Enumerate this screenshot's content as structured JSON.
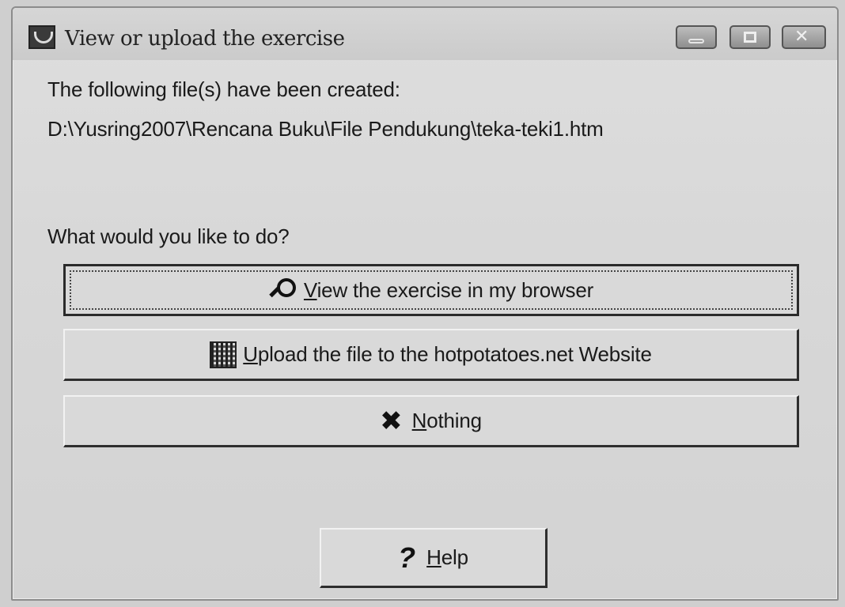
{
  "window": {
    "title": "View or upload the exercise",
    "controls": {
      "minimize": "minimize",
      "maximize": "maximize",
      "close": "close"
    }
  },
  "message": {
    "created_line": "The following file(s) have been created:",
    "file_path": "D:\\Yusring2007\\Rencana Buku\\File Pendukung\\teka-teki1.htm",
    "question": "What would you like to do?"
  },
  "buttons": {
    "view": {
      "mnemonic": "V",
      "rest": "iew the exercise in my browser",
      "icon": "magnifier-icon"
    },
    "upload": {
      "mnemonic": "U",
      "rest": "pload the file to the hotpotatoes.net Website",
      "icon": "upload-web-icon"
    },
    "nothing": {
      "mnemonic": "N",
      "rest": "othing",
      "icon": "x-mark-icon"
    },
    "help": {
      "mnemonic": "H",
      "rest": "elp",
      "icon": "question-icon"
    }
  }
}
